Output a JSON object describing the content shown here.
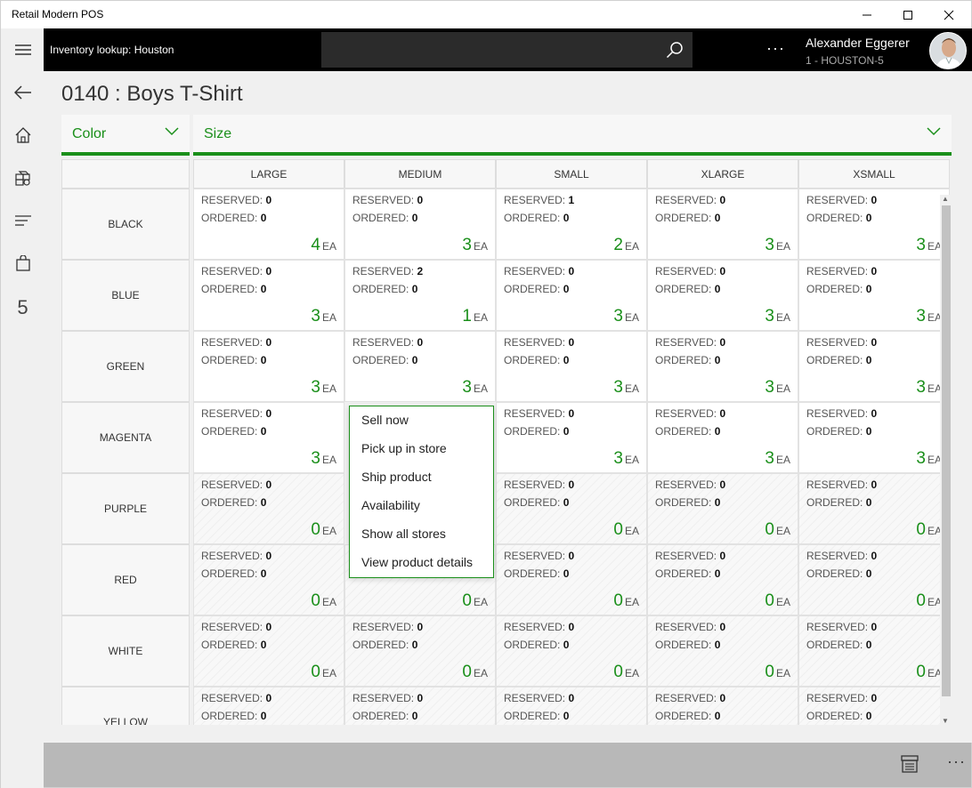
{
  "window": {
    "title": "Retail Modern POS"
  },
  "header": {
    "caption": "Inventory lookup: Houston",
    "search_placeholder": "",
    "more": "···",
    "user_name": "Alexander Eggerer",
    "user_store": "1 - HOUSTON-5"
  },
  "nav": {
    "number_label": "5"
  },
  "product": {
    "title": "0140 : Boys T-Shirt"
  },
  "filters": {
    "color_label": "Color",
    "size_label": "Size"
  },
  "labels": {
    "reserved": "RESERVED:",
    "ordered": "ORDERED:",
    "unit": "EA"
  },
  "sizes": [
    "LARGE",
    "MEDIUM",
    "SMALL",
    "XLARGE",
    "XSMALL"
  ],
  "rows": [
    {
      "color": "BLACK",
      "cells": [
        {
          "reserved": "0",
          "ordered": "0",
          "qty": "4"
        },
        {
          "reserved": "0",
          "ordered": "0",
          "qty": "3"
        },
        {
          "reserved": "1",
          "ordered": "0",
          "qty": "2"
        },
        {
          "reserved": "0",
          "ordered": "0",
          "qty": "3"
        },
        {
          "reserved": "0",
          "ordered": "0",
          "qty": "3"
        }
      ]
    },
    {
      "color": "BLUE",
      "cells": [
        {
          "reserved": "0",
          "ordered": "0",
          "qty": "3"
        },
        {
          "reserved": "2",
          "ordered": "0",
          "qty": "1"
        },
        {
          "reserved": "0",
          "ordered": "0",
          "qty": "3"
        },
        {
          "reserved": "0",
          "ordered": "0",
          "qty": "3"
        },
        {
          "reserved": "0",
          "ordered": "0",
          "qty": "3"
        }
      ]
    },
    {
      "color": "GREEN",
      "cells": [
        {
          "reserved": "0",
          "ordered": "0",
          "qty": "3"
        },
        {
          "reserved": "0",
          "ordered": "0",
          "qty": "3"
        },
        {
          "reserved": "0",
          "ordered": "0",
          "qty": "3"
        },
        {
          "reserved": "0",
          "ordered": "0",
          "qty": "3"
        },
        {
          "reserved": "0",
          "ordered": "0",
          "qty": "3"
        }
      ]
    },
    {
      "color": "MAGENTA",
      "cells": [
        {
          "reserved": "0",
          "ordered": "0",
          "qty": "3"
        },
        null,
        {
          "reserved": "0",
          "ordered": "0",
          "qty": "3"
        },
        {
          "reserved": "0",
          "ordered": "0",
          "qty": "3"
        },
        {
          "reserved": "0",
          "ordered": "0",
          "qty": "3"
        }
      ]
    },
    {
      "color": "PURPLE",
      "cells": [
        {
          "reserved": "0",
          "ordered": "0",
          "qty": "0"
        },
        null,
        {
          "reserved": "0",
          "ordered": "0",
          "qty": "0"
        },
        {
          "reserved": "0",
          "ordered": "0",
          "qty": "0"
        },
        {
          "reserved": "0",
          "ordered": "0",
          "qty": "0"
        }
      ]
    },
    {
      "color": "RED",
      "cells": [
        {
          "reserved": "0",
          "ordered": "0",
          "qty": "0"
        },
        {
          "reserved": null,
          "ordered": null,
          "qty": "0"
        },
        {
          "reserved": "0",
          "ordered": "0",
          "qty": "0"
        },
        {
          "reserved": "0",
          "ordered": "0",
          "qty": "0"
        },
        {
          "reserved": "0",
          "ordered": "0",
          "qty": "0"
        }
      ]
    },
    {
      "color": "WHITE",
      "cells": [
        {
          "reserved": "0",
          "ordered": "0",
          "qty": "0"
        },
        {
          "reserved": "0",
          "ordered": "0",
          "qty": "0"
        },
        {
          "reserved": "0",
          "ordered": "0",
          "qty": "0"
        },
        {
          "reserved": "0",
          "ordered": "0",
          "qty": "0"
        },
        {
          "reserved": "0",
          "ordered": "0",
          "qty": "0"
        }
      ]
    },
    {
      "color": "YELLOW",
      "cells": [
        {
          "reserved": "0",
          "ordered": "0",
          "qty": null
        },
        {
          "reserved": "0",
          "ordered": "0",
          "qty": null
        },
        {
          "reserved": "0",
          "ordered": "0",
          "qty": null
        },
        {
          "reserved": "0",
          "ordered": "0",
          "qty": null
        },
        {
          "reserved": "0",
          "ordered": "0",
          "qty": null
        }
      ]
    }
  ],
  "context_menu": [
    "Sell now",
    "Pick up in store",
    "Ship product",
    "Availability",
    "Show all stores",
    "View product details"
  ],
  "bottom": {
    "more": "···"
  },
  "colors": {
    "accent": "#1a8f1a",
    "header_bg": "#000000",
    "bottom_bar": "#b8b8b8"
  }
}
